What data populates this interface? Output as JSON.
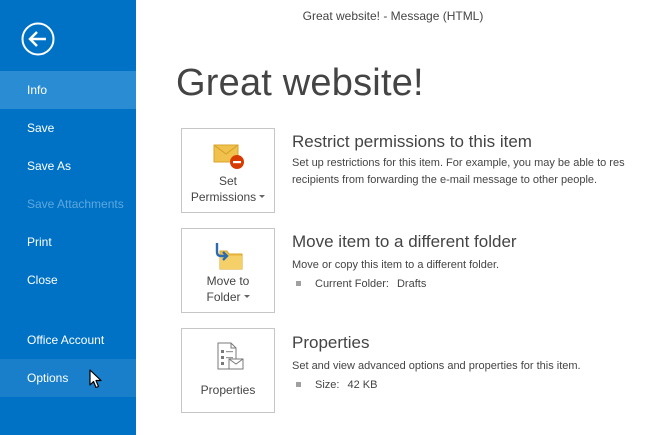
{
  "window": {
    "title": "Great website! - Message (HTML)"
  },
  "sidebar": {
    "back_icon": "back-arrow-icon",
    "items": [
      {
        "label": "Info",
        "state": "selected"
      },
      {
        "label": "Save",
        "state": "normal"
      },
      {
        "label": "Save As",
        "state": "normal"
      },
      {
        "label": "Save Attachments",
        "state": "disabled"
      },
      {
        "label": "Print",
        "state": "normal"
      },
      {
        "label": "Close",
        "state": "normal"
      },
      {
        "label": "Office Account",
        "state": "normal"
      },
      {
        "label": "Options",
        "state": "hover"
      }
    ]
  },
  "main": {
    "page_title": "Great website!",
    "sections": [
      {
        "button_line1": "Set",
        "button_line2": "Permissions",
        "icon": "envelope-restrict-icon",
        "heading": "Restrict permissions to this item",
        "desc_line1": "Set up restrictions for this item. For example, you may be able to res",
        "desc_line2": "recipients from forwarding the e-mail message to other people."
      },
      {
        "button_line1": "Move to",
        "button_line2": "Folder",
        "icon": "move-folder-icon",
        "heading": "Move item to a different folder",
        "desc_line1": "Move or copy this item to a different folder.",
        "detail_label": "Current Folder:",
        "detail_value": "Drafts"
      },
      {
        "button_line1": "Properties",
        "icon": "properties-document-icon",
        "heading": "Properties",
        "desc_line1": "Set and view advanced options and properties for this item.",
        "detail_label": "Size:",
        "detail_value": "42 KB"
      }
    ]
  },
  "colors": {
    "sidebar_bg": "#0072c6",
    "selected_bg": "#2a8dd4",
    "hover_bg": "#1a7fca",
    "disabled_text": "#5ea7dd",
    "envelope": "#f0c14d",
    "restrict_red": "#d83b01",
    "arrow_blue": "#2b6cb0"
  }
}
